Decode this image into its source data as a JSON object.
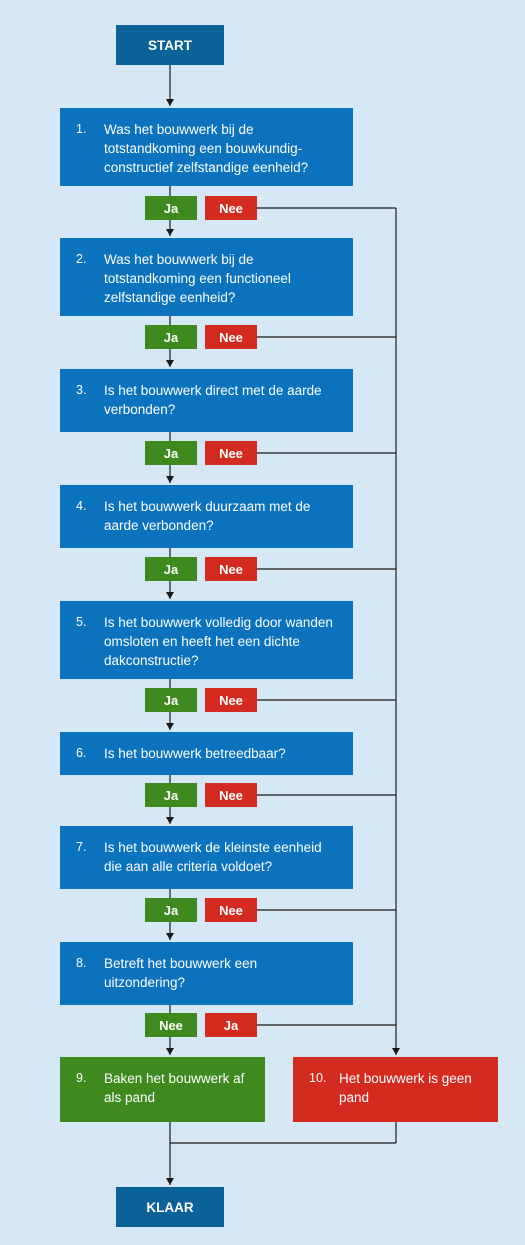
{
  "start_label": "START",
  "end_label": "KLAAR",
  "questions": [
    {
      "number": "1.",
      "text": "Was het bouwwerk bij de totstandkoming een bouwkundig-constructief zelfstandige eenheid?",
      "left": "Ja",
      "right": "Nee"
    },
    {
      "number": "2.",
      "text": "Was het bouwwerk bij de totstandkoming een functioneel zelfstandige eenheid?",
      "left": "Ja",
      "right": "Nee"
    },
    {
      "number": "3.",
      "text": "Is het bouwwerk direct met de aarde verbonden?",
      "left": "Ja",
      "right": "Nee"
    },
    {
      "number": "4.",
      "text": "Is het bouwwerk duurzaam met de aarde verbonden?",
      "left": "Ja",
      "right": "Nee"
    },
    {
      "number": "5.",
      "text": "Is het bouwwerk volledig door wanden omsloten en heeft het een dichte dakconstructie?",
      "left": "Ja",
      "right": "Nee"
    },
    {
      "number": "6.",
      "text": "Is het bouwwerk betreedbaar?",
      "left": "Ja",
      "right": "Nee"
    },
    {
      "number": "7.",
      "text": "Is het bouwwerk de kleinste eenheid die aan alle criteria voldoet?",
      "left": "Ja",
      "right": "Nee"
    },
    {
      "number": "8.",
      "text": "Betreft het bouwwerk een uitzondering?",
      "left": "Nee",
      "right": "Ja"
    }
  ],
  "outcome_pand": {
    "number": "9.",
    "text": "Baken het bouwwerk af als pand"
  },
  "outcome_geen": {
    "number": "10.",
    "text": "Het bouwwerk is geen pand"
  },
  "colors": {
    "background": "#d6e8f5",
    "question": "#0b72bd",
    "terminal": "#0a6299",
    "yes": "#3f8a1e",
    "no": "#d42b20",
    "line": "#1a1a1a"
  }
}
